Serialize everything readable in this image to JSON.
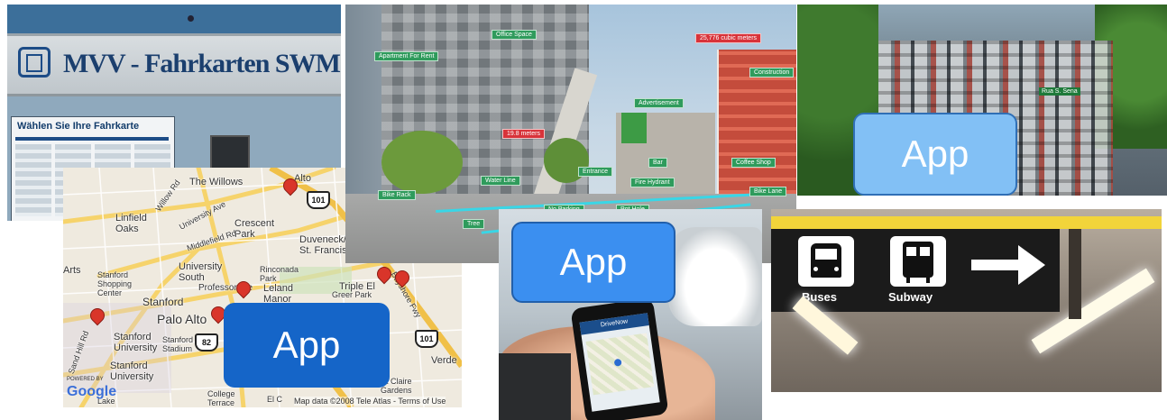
{
  "ticket_machine": {
    "sign_text": "MVV - Fahrkarten SWM",
    "header": "Wählen Sie Ihre Fahrkarte"
  },
  "ar_street": {
    "tags": [
      {
        "text": "Apartment For Rent",
        "color": "green"
      },
      {
        "text": "Office Space",
        "color": "green"
      },
      {
        "text": "25,776 cubic meters",
        "color": "red"
      },
      {
        "text": "Construction",
        "color": "green"
      },
      {
        "text": "Advertisement",
        "color": "green"
      },
      {
        "text": "19.8 meters",
        "color": "red"
      },
      {
        "text": "Bar",
        "color": "green"
      },
      {
        "text": "Coffee Shop",
        "color": "green"
      },
      {
        "text": "Entrance",
        "color": "green"
      },
      {
        "text": "Fire Hydrant",
        "color": "green"
      },
      {
        "text": "Water Line",
        "color": "green"
      },
      {
        "text": "Bike Rack",
        "color": "green"
      },
      {
        "text": "Bike Lane",
        "color": "green"
      },
      {
        "text": "Tree",
        "color": "green"
      },
      {
        "text": "No Parking",
        "color": "green"
      },
      {
        "text": "Pot Hole",
        "color": "green"
      }
    ]
  },
  "traffic": {
    "app_label": "App",
    "road_sign": "Rua S. Sena"
  },
  "map": {
    "labels": [
      "The Willows",
      "Alto",
      "Linfield Oaks",
      "Crescent Park",
      "Duveneck/ St. Francis",
      "Arts",
      "Stanford Shopping Center",
      "University South",
      "Rinconada Park",
      "Professorville",
      "Leland Manor",
      "Triple El",
      "Greer Park",
      "Stanford",
      "Palo Alto",
      "Stanford University",
      "Stanford Stadium",
      "Stanford University",
      "College Terrace",
      "Verde",
      "St Claire Gardens",
      "Lake"
    ],
    "roads": [
      "Willow Rd",
      "University Ave",
      "Middlefield Rd",
      "Bayshore Fwy",
      "Sand Hill Rd",
      "El C"
    ],
    "shields": [
      "101",
      "101",
      "82"
    ],
    "attribution": "Map data ©2008 Tele Atlas - Terms of Use",
    "powered": "POWERED BY",
    "google": "Google",
    "app_label": "App"
  },
  "phone": {
    "app_label": "App",
    "screen_brand": "DriveNow"
  },
  "subway_sign": {
    "buses_label": "Buses",
    "subway_label": "Subway"
  }
}
